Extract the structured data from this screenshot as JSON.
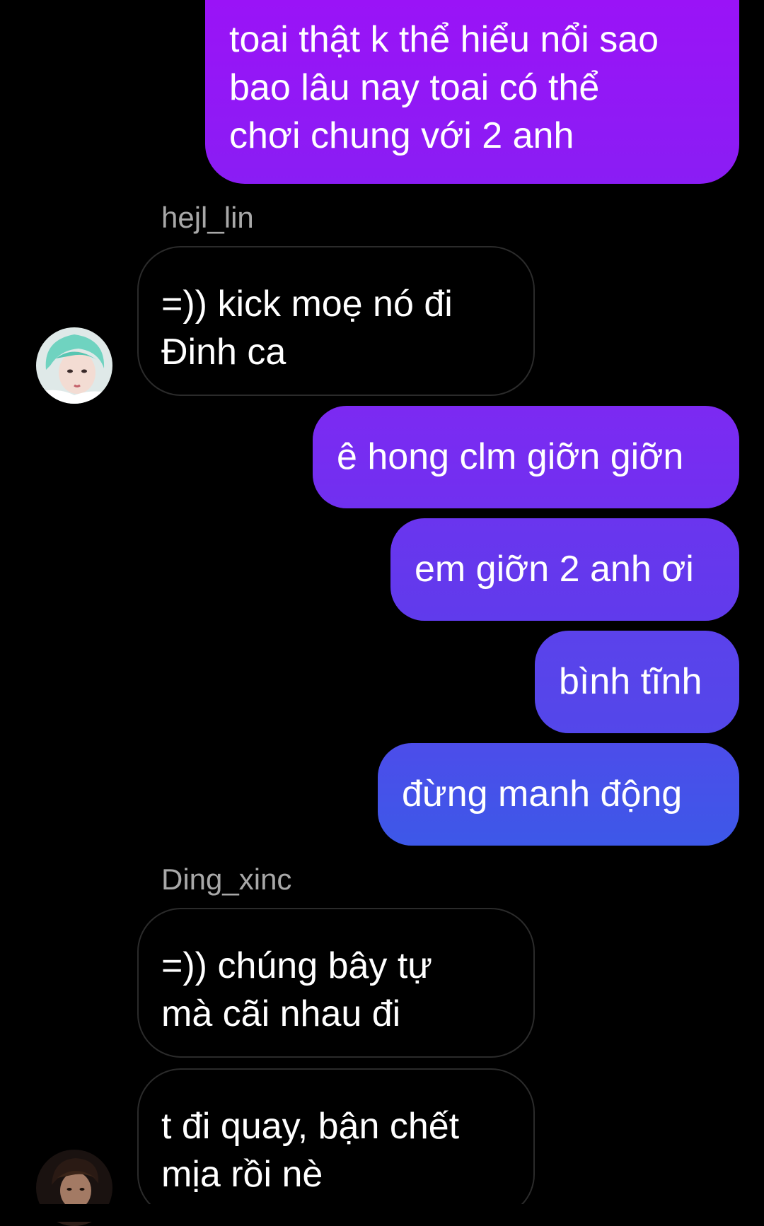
{
  "conversation": {
    "messages": [
      {
        "from": "me",
        "text": "toai thật k thể hiểu nổi sao\nbao lâu nay toai có thể\nchơi chung với 2 anh"
      },
      {
        "from": "hejl_lin",
        "sender_label": "hejl_lin",
        "text": "=)) kick moẹ nó đi\nĐinh ca"
      },
      {
        "from": "me",
        "text": "ê hong clm giỡn giỡn"
      },
      {
        "from": "me",
        "text": "em giỡn 2 anh ơi"
      },
      {
        "from": "me",
        "text": "bình tĩnh"
      },
      {
        "from": "me",
        "text": "đừng manh động"
      },
      {
        "from": "Ding_xinc",
        "sender_label": "Ding_xinc",
        "text": "=)) chúng bây tự\nmà cãi nhau đi"
      },
      {
        "from": "Ding_xinc",
        "text": "t đi quay, bận chết\nmịa rồi nè"
      }
    ],
    "avatars": {
      "hejl_lin": "avatar-teal-hair-photo",
      "Ding_xinc": "avatar-dark-photo"
    }
  },
  "colors": {
    "background": "#000000",
    "outgoing_gradient_top": "#8f1cf5",
    "outgoing_gradient_bottom": "#3e57e8",
    "incoming_border": "#2b2b2b",
    "sender_name": "#a8a8a8"
  }
}
